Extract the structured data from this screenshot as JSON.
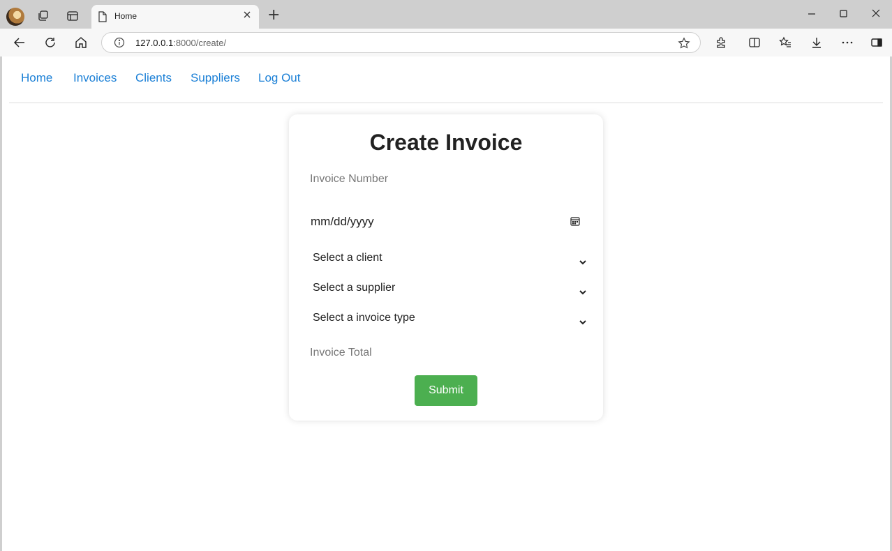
{
  "browser": {
    "tab_title": "Home",
    "new_tab_label": "+",
    "url_host": "127.0.0.1",
    "url_rest": ":8000/create/"
  },
  "nav": {
    "items": [
      "Home",
      "Invoices",
      "Clients",
      "Suppliers",
      "Log Out"
    ]
  },
  "form": {
    "title": "Create Invoice",
    "invoice_number_placeholder": "Invoice Number",
    "date_placeholder": "mm/dd/yyyy",
    "client_select": "Select a client",
    "supplier_select": "Select a supplier",
    "invoice_type_select": "Select a invoice type",
    "invoice_total_placeholder": "Invoice Total",
    "submit_label": "Submit"
  },
  "colors": {
    "link": "#1a7fd6",
    "submit_bg": "#4caf50",
    "chrome_bg": "#cfcfcf"
  },
  "icons": [
    "profile-avatar",
    "workspaces-icon",
    "tab-actions-icon",
    "page-icon",
    "close-icon",
    "back-icon",
    "refresh-icon",
    "home-icon",
    "info-icon",
    "star-icon",
    "extensions-icon",
    "split-screen-icon",
    "favorites-icon",
    "download-icon",
    "more-icon",
    "sidebar-icon",
    "calendar-icon",
    "chevron-down-icon"
  ]
}
